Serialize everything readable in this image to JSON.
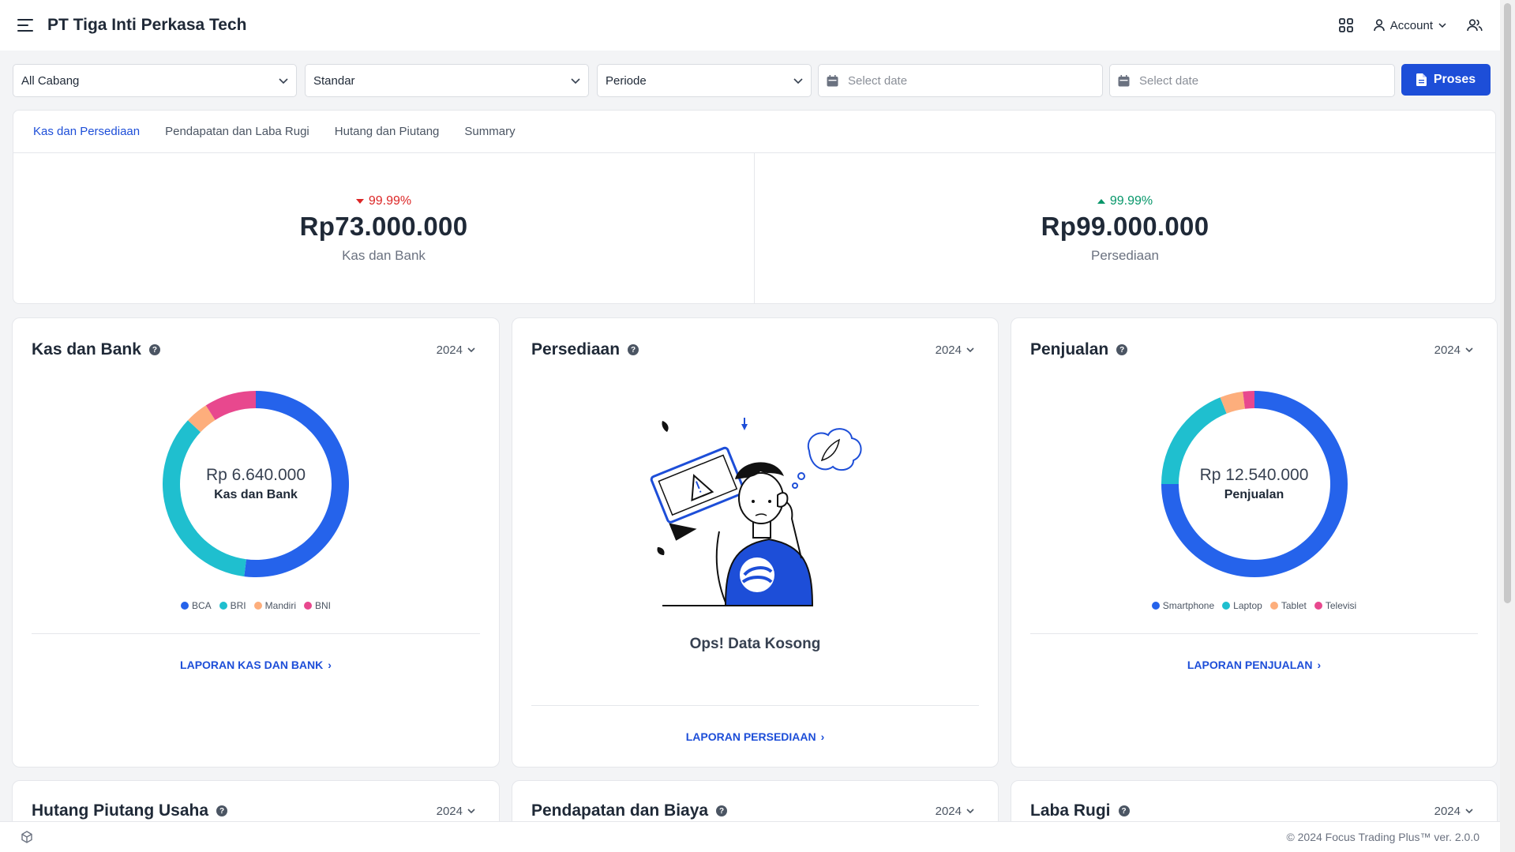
{
  "header": {
    "company": "PT Tiga Inti Perkasa Tech",
    "account_label": "Account"
  },
  "filters": {
    "branch": "All Cabang",
    "mode": "Standar",
    "period": "Periode",
    "date_start_placeholder": "Select date",
    "date_end_placeholder": "Select date",
    "process_label": "Proses"
  },
  "tabs": [
    {
      "label": "Kas dan Persediaan",
      "active": true
    },
    {
      "label": "Pendapatan dan Laba Rugi",
      "active": false
    },
    {
      "label": "Hutang dan Piutang",
      "active": false
    },
    {
      "label": "Summary",
      "active": false
    }
  ],
  "summary": [
    {
      "trend": "down",
      "percent": "99.99%",
      "value": "Rp73.000.000",
      "label": "Kas dan Bank"
    },
    {
      "trend": "up",
      "percent": "99.99%",
      "value": "Rp99.000.000",
      "label": "Persediaan"
    }
  ],
  "cards": {
    "kas_bank": {
      "title": "Kas dan Bank",
      "year": "2024",
      "center_amount": "Rp 6.640.000",
      "center_label": "Kas dan Bank",
      "report_link": "LAPORAN KAS DAN BANK"
    },
    "persediaan": {
      "title": "Persediaan",
      "year": "2024",
      "empty_text": "Ops! Data Kosong",
      "report_link": "LAPORAN PERSEDIAAN"
    },
    "penjualan": {
      "title": "Penjualan",
      "year": "2024",
      "center_amount": "Rp 12.540.000",
      "center_label": "Penjualan",
      "report_link": "LAPORAN PENJUALAN"
    },
    "hutang_piutang": {
      "title": "Hutang Piutang Usaha",
      "year": "2024"
    },
    "pendapatan_biaya": {
      "title": "Pendapatan dan Biaya",
      "year": "2024"
    },
    "laba_rugi": {
      "title": "Laba Rugi",
      "year": "2024"
    }
  },
  "chart_data": [
    {
      "type": "pie",
      "categories": [
        "BCA",
        "BRI",
        "Mandiri",
        "BNI"
      ],
      "values": [
        52,
        35,
        4,
        9
      ],
      "colors": [
        "#2563eb",
        "#1fbfcf",
        "#fdae7c",
        "#e8488e"
      ]
    },
    {
      "type": "pie",
      "categories": [
        "Smartphone",
        "Laptop",
        "Tablet",
        "Televisi"
      ],
      "values": [
        75,
        19,
        4,
        2
      ],
      "colors": [
        "#2563eb",
        "#1fbfcf",
        "#fdae7c",
        "#e8488e"
      ]
    }
  ],
  "footer": {
    "copyright": "© 2024 Focus Trading Plus™ ver. 2.0.0"
  },
  "icons": {
    "menu": "menu-icon",
    "apps": "grid-icon",
    "account": "user-icon",
    "users": "users-icon",
    "calendar": "calendar-icon",
    "document": "document-icon",
    "help": "help-icon",
    "footer": "cube-icon"
  }
}
